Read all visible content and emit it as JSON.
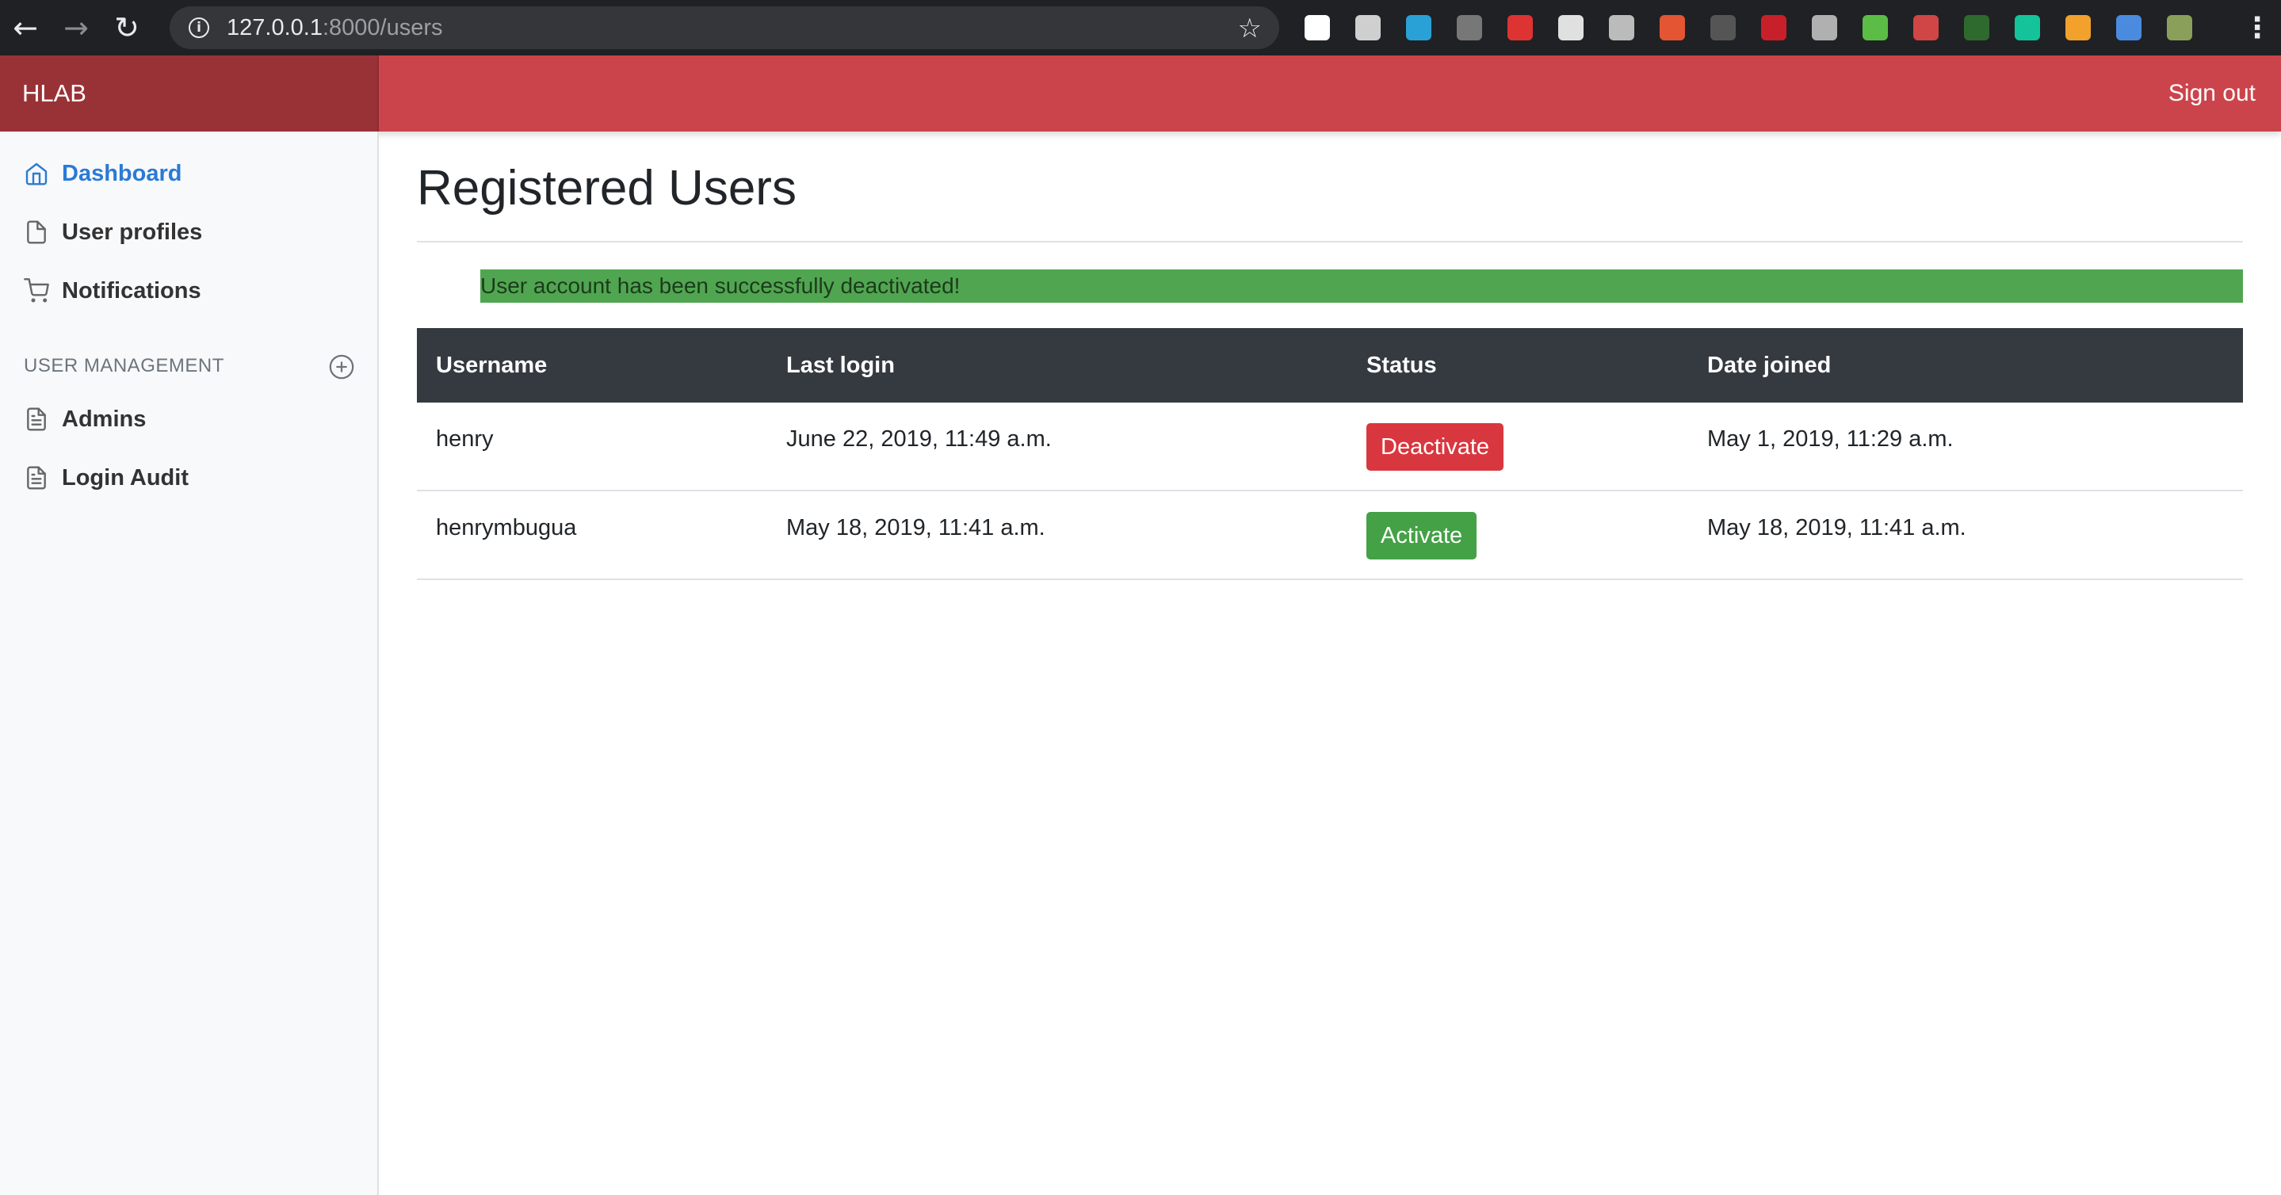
{
  "browser": {
    "url_host": "127.0.0.1",
    "url_rest": ":8000/users",
    "extensions": [
      {
        "name": "back-arrow-ext-icon",
        "color": "#ffffff"
      },
      {
        "name": "function-ext-icon",
        "color": "#cfcfcf"
      },
      {
        "name": "react-ext-icon",
        "color": "#2aa1d6"
      },
      {
        "name": "css-ext-icon",
        "color": "#777777"
      },
      {
        "name": "angular-ext-icon",
        "color": "#dd3333"
      },
      {
        "name": "card-ext-icon",
        "color": "#e0e0e0"
      },
      {
        "name": "gear-ext-icon",
        "color": "#bbbbbb"
      },
      {
        "name": "bricks-ext-icon",
        "color": "#e35533"
      },
      {
        "name": "code-ext-icon",
        "color": "#555555"
      },
      {
        "name": "m-ext-icon",
        "color": "#c8202a"
      },
      {
        "name": "v-ext-icon",
        "color": "#b0b0b0"
      },
      {
        "name": "download-ext-icon",
        "color": "#5bbd45"
      },
      {
        "name": "globe-ext-icon",
        "color": "#d04545"
      },
      {
        "name": "leaf-ext-icon",
        "color": "#2e6a2e"
      },
      {
        "name": "grammarly-ext-icon",
        "color": "#15c39a"
      },
      {
        "name": "rss-ext-icon",
        "color": "#f2a12d"
      },
      {
        "name": "cast-ext-icon",
        "color": "#4a8be0"
      },
      {
        "name": "avatar-ext-icon",
        "color": "#8aa05a"
      }
    ]
  },
  "navbar": {
    "brand": "HLAB",
    "signout": "Sign out",
    "color": "#cc444b",
    "brand_color": "#993237"
  },
  "sidebar": {
    "items": [
      {
        "label": "Dashboard",
        "icon": "home-icon",
        "active": true
      },
      {
        "label": "User profiles",
        "icon": "file-icon"
      },
      {
        "label": "Notifications",
        "icon": "cart-icon"
      }
    ],
    "heading": "USER MANAGEMENT",
    "heading_action_icon": "plus-circle-icon",
    "management_items": [
      {
        "label": "Admins",
        "icon": "file-text-icon"
      },
      {
        "label": "Login Audit",
        "icon": "file-text-icon"
      }
    ]
  },
  "main": {
    "title": "Registered Users",
    "alert": "User account has been successfully deactivated!",
    "table": {
      "headers": [
        "Username",
        "Last login",
        "Status",
        "Date joined"
      ],
      "rows": [
        {
          "username": "henry",
          "last_login": "June 22, 2019, 11:49 a.m.",
          "status_action": "Deactivate",
          "date_joined": "May 1, 2019, 11:29 a.m."
        },
        {
          "username": "henrymbugua",
          "last_login": "May 18, 2019, 11:41 a.m.",
          "status_action": "Activate",
          "date_joined": "May 18, 2019, 11:41 a.m."
        }
      ]
    }
  }
}
